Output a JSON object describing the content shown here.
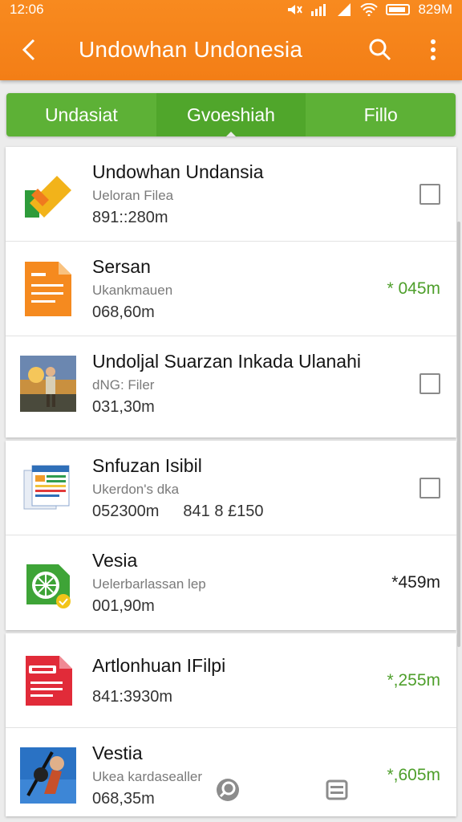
{
  "status_bar": {
    "time": "12:06",
    "battery_text": "829M"
  },
  "app_bar": {
    "title": "Undowhan Undonesia"
  },
  "tabs": [
    {
      "label": "Undasiat"
    },
    {
      "label": "Gvoeshiah"
    },
    {
      "label": "Fillo"
    }
  ],
  "files": [
    {
      "title": "Undowhan Undansia",
      "subtitle": "Ueloran Filea",
      "meta": "891::280m",
      "trailing": "checkbox",
      "icon": "app-logo-icon"
    },
    {
      "title": "Sersan",
      "subtitle": "Ukankmauen",
      "meta": "068,60m",
      "trailing": "size",
      "size": "* 045m",
      "icon": "document-icon"
    },
    {
      "title": "Undoljal Suarzan Inkada Ulanahi",
      "subtitle": "dNG: Filer",
      "meta": "031,30m",
      "trailing": "checkbox",
      "icon": "photo-thumbnail"
    },
    {
      "title": "Snfuzan Isibil",
      "subtitle": "Ukerdon's dka",
      "meta": "052300m",
      "meta2": "841 8 £150",
      "trailing": "checkbox",
      "icon": "spreadsheet-icon"
    },
    {
      "title": "Vesia",
      "subtitle": "Uelerbarlassan lep",
      "meta": "001,90m",
      "trailing": "size",
      "size": "*459m",
      "size_dark": true,
      "icon": "app-green-icon"
    },
    {
      "title": "Artlonhuan IFilpi",
      "subtitle": "",
      "meta": "841:3930m",
      "trailing": "size",
      "size": "*,255m",
      "icon": "pdf-icon"
    },
    {
      "title": "Vestia",
      "subtitle": "Ukea kardasealler",
      "meta": "068,35m",
      "trailing": "size",
      "size": "*,605m",
      "icon": "photo-thumbnail-2"
    }
  ],
  "colors": {
    "header": "#f37e16",
    "tabs": "#5db136",
    "size_green": "#4e9f2b"
  }
}
